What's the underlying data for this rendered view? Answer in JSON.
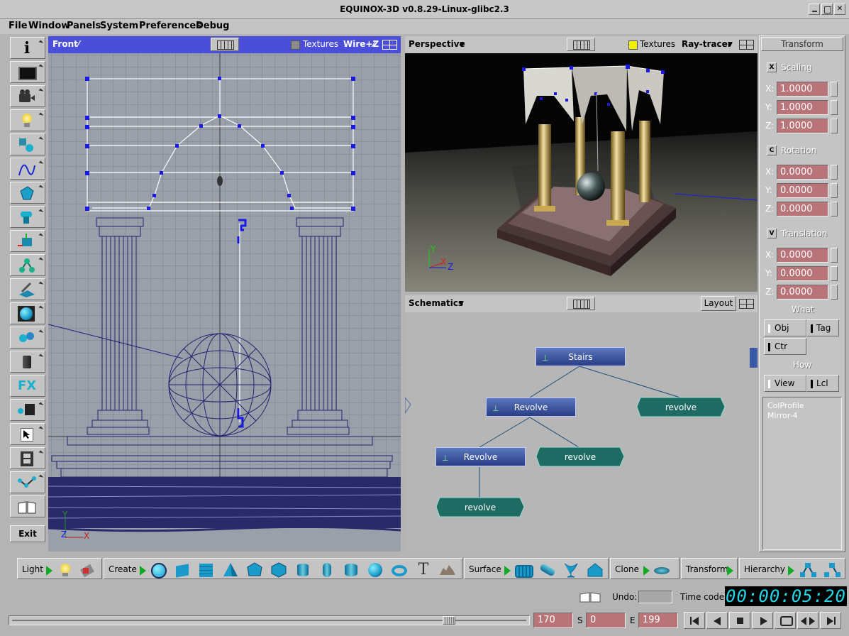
{
  "window": {
    "title": "EQUINOX-3D v0.8.29-Linux-glibc2.3"
  },
  "menubar": {
    "items": [
      "File",
      "Window",
      "Panels",
      "System",
      "Preferences",
      "Debug"
    ]
  },
  "left_toolbar": {
    "tools": [
      "info-icon",
      "display-icon",
      "camera-icon",
      "light-bulb-icon",
      "primitives-icon",
      "spline-icon",
      "polygon-icon",
      "extrude-icon",
      "transform-icon",
      "hierarchy-icon",
      "deform-icon",
      "sphere-icon",
      "bones-icon",
      "trash-icon",
      "fx-icon",
      "render-icon",
      "pointer-icon",
      "film-icon",
      "joint-icon",
      "book-icon"
    ],
    "fx_label": "FX",
    "exit_label": "Exit"
  },
  "front_view": {
    "name": "Front",
    "menu_mark": "⁄",
    "textures_label": "Textures",
    "mode": "Wire+Z",
    "axis_y": "Y",
    "axis_z": "Z",
    "axis_x": "X"
  },
  "perspective_view": {
    "name": "Perspective",
    "textures_label": "Textures",
    "renderer": "Ray-tracer",
    "axis_y": "Y",
    "axis_x": "X",
    "axis_z": "Z"
  },
  "schematics": {
    "name": "Schematics",
    "layout_label": "Layout",
    "nodes": [
      {
        "label": "Stairs",
        "kind": "object"
      },
      {
        "label": "Revolve",
        "kind": "object"
      },
      {
        "label": "revolve",
        "kind": "generator"
      },
      {
        "label": "Revolve",
        "kind": "object"
      },
      {
        "label": "revolve",
        "kind": "generator"
      },
      {
        "label": "revolve",
        "kind": "generator"
      }
    ]
  },
  "transform_panel": {
    "title": "Transform",
    "scaling": {
      "key": "X",
      "label": "Scaling",
      "x": "1.0000",
      "y": "1.0000",
      "z": "1.0000"
    },
    "rotation": {
      "key": "C",
      "label": "Rotation",
      "x": "0.0000",
      "y": "0.0000",
      "z": "0.0000"
    },
    "translation": {
      "key": "V",
      "label": "Translation",
      "x": "0.0000",
      "y": "0.0000",
      "z": "0.0000"
    },
    "axis_x": "X:",
    "axis_y": "Y:",
    "axis_z": "Z:",
    "what_label": "What",
    "what_buttons": [
      "Obj",
      "Tag",
      "Ctr"
    ],
    "how_label": "How",
    "how_buttons": [
      "View",
      "Lcl"
    ],
    "list": [
      "ColProfile",
      "Mirror-4"
    ]
  },
  "create_bar": {
    "groups": [
      "Light",
      "Create",
      "Surface",
      "Clone",
      "Transform",
      "Hierarchy"
    ]
  },
  "status": {
    "undo_label": "Undo:",
    "timecode_label": "Time code",
    "timecode": "00:00:05:20"
  },
  "timeline": {
    "current": "170",
    "start_label": "S",
    "start": "0",
    "end_label": "E",
    "end": "199",
    "slider_fraction": 0.854
  },
  "colors": {
    "accent_blue": "#4a4ed8",
    "field_red": "#b87478",
    "timecode_bg": "#000000",
    "timecode_fg": "#22d8e8",
    "node_blue": "#2a3d84",
    "node_teal": "#1e6b64"
  }
}
